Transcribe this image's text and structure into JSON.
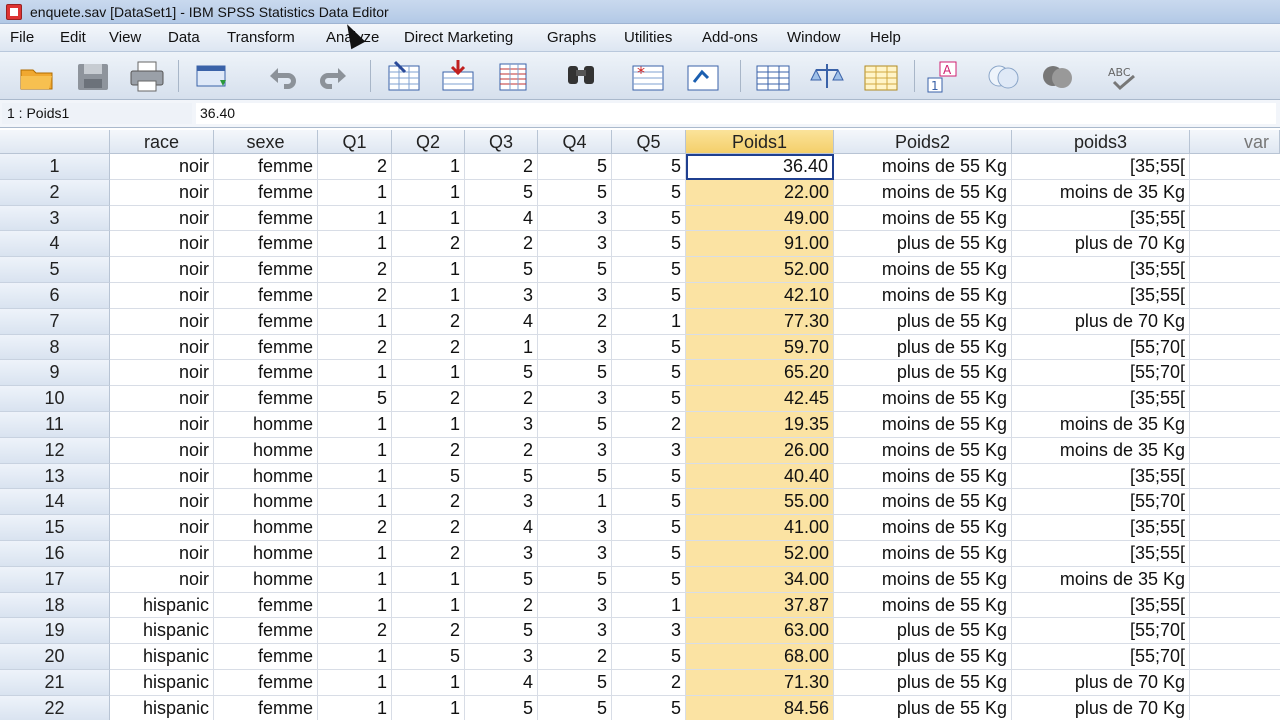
{
  "window": {
    "title": "enquete.sav [DataSet1] - IBM SPSS Statistics Data Editor"
  },
  "menu": [
    "File",
    "Edit",
    "View",
    "Data",
    "Transform",
    "Analyze",
    "Direct Marketing",
    "Graphs",
    "Utilities",
    "Add-ons",
    "Window",
    "Help"
  ],
  "toolbar": {
    "icons": [
      "open-folder-icon",
      "save-icon",
      "print-icon",
      "dialog-recall-icon",
      "undo-icon",
      "redo-icon",
      "go-to-case-icon",
      "go-to-variable-icon",
      "variables-icon",
      "find-icon",
      "insert-cases-icon",
      "insert-variable-icon",
      "split-file-icon",
      "weight-cases-icon",
      "select-cases-icon",
      "value-labels-icon",
      "use-variable-sets-icon",
      "show-all-variables-icon",
      "spell-check-icon"
    ]
  },
  "cellbar": {
    "ref": "1 : Poids1",
    "value": "36.40"
  },
  "grid": {
    "columns": [
      "race",
      "sexe",
      "Q1",
      "Q2",
      "Q3",
      "Q4",
      "Q5",
      "Poids1",
      "Poids2",
      "poids3",
      "var"
    ],
    "rows": [
      [
        "1",
        "noir",
        "femme",
        "2",
        "1",
        "2",
        "5",
        "5",
        "36.40",
        "moins de 55 Kg",
        "[35;55["
      ],
      [
        "2",
        "noir",
        "femme",
        "1",
        "1",
        "5",
        "5",
        "5",
        "22.00",
        "moins de 55 Kg",
        "moins de 35 Kg"
      ],
      [
        "3",
        "noir",
        "femme",
        "1",
        "1",
        "4",
        "3",
        "5",
        "49.00",
        "moins de 55 Kg",
        "[35;55["
      ],
      [
        "4",
        "noir",
        "femme",
        "1",
        "2",
        "2",
        "3",
        "5",
        "91.00",
        "plus de 55 Kg",
        "plus de 70 Kg"
      ],
      [
        "5",
        "noir",
        "femme",
        "2",
        "1",
        "5",
        "5",
        "5",
        "52.00",
        "moins de 55 Kg",
        "[35;55["
      ],
      [
        "6",
        "noir",
        "femme",
        "2",
        "1",
        "3",
        "3",
        "5",
        "42.10",
        "moins de 55 Kg",
        "[35;55["
      ],
      [
        "7",
        "noir",
        "femme",
        "1",
        "2",
        "4",
        "2",
        "1",
        "77.30",
        "plus de 55 Kg",
        "plus de 70 Kg"
      ],
      [
        "8",
        "noir",
        "femme",
        "2",
        "2",
        "1",
        "3",
        "5",
        "59.70",
        "plus de 55 Kg",
        "[55;70["
      ],
      [
        "9",
        "noir",
        "femme",
        "1",
        "1",
        "5",
        "5",
        "5",
        "65.20",
        "plus de 55 Kg",
        "[55;70["
      ],
      [
        "10",
        "noir",
        "femme",
        "5",
        "2",
        "2",
        "3",
        "5",
        "42.45",
        "moins de 55 Kg",
        "[35;55["
      ],
      [
        "11",
        "noir",
        "homme",
        "1",
        "1",
        "3",
        "5",
        "2",
        "19.35",
        "moins de 55 Kg",
        "moins de 35 Kg"
      ],
      [
        "12",
        "noir",
        "homme",
        "1",
        "2",
        "2",
        "3",
        "3",
        "26.00",
        "moins de 55 Kg",
        "moins de 35 Kg"
      ],
      [
        "13",
        "noir",
        "homme",
        "1",
        "5",
        "5",
        "5",
        "5",
        "40.40",
        "moins de 55 Kg",
        "[35;55["
      ],
      [
        "14",
        "noir",
        "homme",
        "1",
        "2",
        "3",
        "1",
        "5",
        "55.00",
        "moins de 55 Kg",
        "[55;70["
      ],
      [
        "15",
        "noir",
        "homme",
        "2",
        "2",
        "4",
        "3",
        "5",
        "41.00",
        "moins de 55 Kg",
        "[35;55["
      ],
      [
        "16",
        "noir",
        "homme",
        "1",
        "2",
        "3",
        "3",
        "5",
        "52.00",
        "moins de 55 Kg",
        "[35;55["
      ],
      [
        "17",
        "noir",
        "homme",
        "1",
        "1",
        "5",
        "5",
        "5",
        "34.00",
        "moins de 55 Kg",
        "moins de 35 Kg"
      ],
      [
        "18",
        "hispanic",
        "femme",
        "1",
        "1",
        "2",
        "3",
        "1",
        "37.87",
        "moins de 55 Kg",
        "[35;55["
      ],
      [
        "19",
        "hispanic",
        "femme",
        "2",
        "2",
        "5",
        "3",
        "3",
        "63.00",
        "plus de 55 Kg",
        "[55;70["
      ],
      [
        "20",
        "hispanic",
        "femme",
        "1",
        "5",
        "3",
        "2",
        "5",
        "68.00",
        "plus de 55 Kg",
        "[55;70["
      ],
      [
        "21",
        "hispanic",
        "femme",
        "1",
        "1",
        "4",
        "5",
        "2",
        "71.30",
        "plus de 55 Kg",
        "plus de 70 Kg"
      ],
      [
        "22",
        "hispanic",
        "femme",
        "1",
        "1",
        "5",
        "5",
        "5",
        "84.56",
        "plus de 55 Kg",
        "plus de 70 Kg"
      ]
    ]
  },
  "colors": {
    "highlight": "#fbe3a3",
    "selection_border": "#1f3f8f",
    "header_bg": "#dfe7f2"
  }
}
